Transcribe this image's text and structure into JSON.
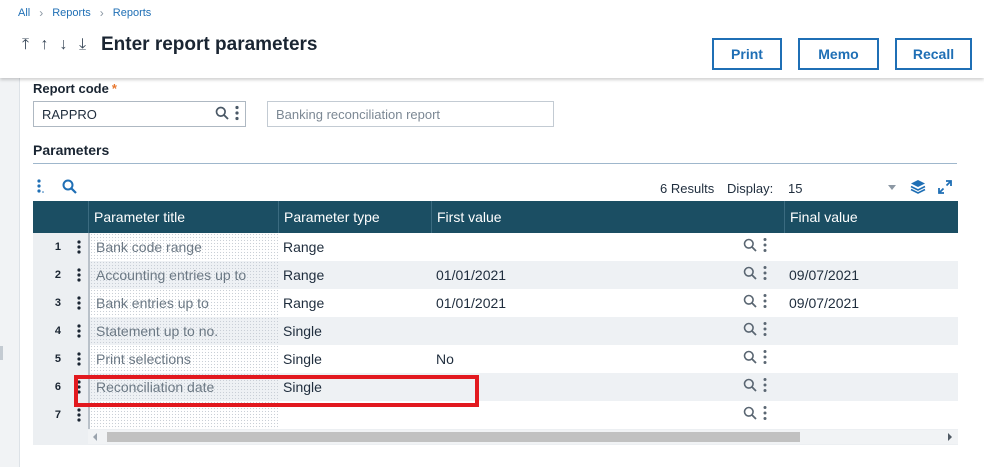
{
  "breadcrumb": [
    "All",
    "Reports",
    "Reports"
  ],
  "page": {
    "title": "Enter report parameters"
  },
  "nav_arrows": [
    "⤒",
    "↑",
    "↓",
    "⤓"
  ],
  "actions": {
    "print": "Print",
    "memo": "Memo",
    "recall": "Recall"
  },
  "form": {
    "report_code_label": "Report code",
    "required_mark": "*",
    "report_code_value": "RAPPRO",
    "report_description": "Banking reconciliation report"
  },
  "parameters": {
    "section_title": "Parameters",
    "results_text": "6 Results",
    "display_label": "Display:",
    "display_value": "15",
    "columns": [
      "Parameter title",
      "Parameter type",
      "First value",
      "Final value"
    ],
    "rows": [
      {
        "num": "1",
        "title": "Bank code range",
        "type": "Range",
        "first": "",
        "final": ""
      },
      {
        "num": "2",
        "title": "Accounting entries up to",
        "type": "Range",
        "first": "01/01/2021",
        "final": "09/07/2021"
      },
      {
        "num": "3",
        "title": "Bank entries up to",
        "type": "Range",
        "first": "01/01/2021",
        "final": "09/07/2021"
      },
      {
        "num": "4",
        "title": "Statement up to no.",
        "type": "Single",
        "first": "",
        "final": ""
      },
      {
        "num": "5",
        "title": "Print selections",
        "type": "Single",
        "first": "No",
        "final": ""
      },
      {
        "num": "6",
        "title": "Reconciliation date",
        "type": "Single",
        "first": "",
        "final": ""
      },
      {
        "num": "7",
        "title": "",
        "type": "",
        "first": "",
        "final": ""
      }
    ]
  },
  "colors": {
    "accent": "#1f6fb5",
    "header": "#1b4e63",
    "highlight": "#e2191f",
    "required": "#e8772e"
  }
}
